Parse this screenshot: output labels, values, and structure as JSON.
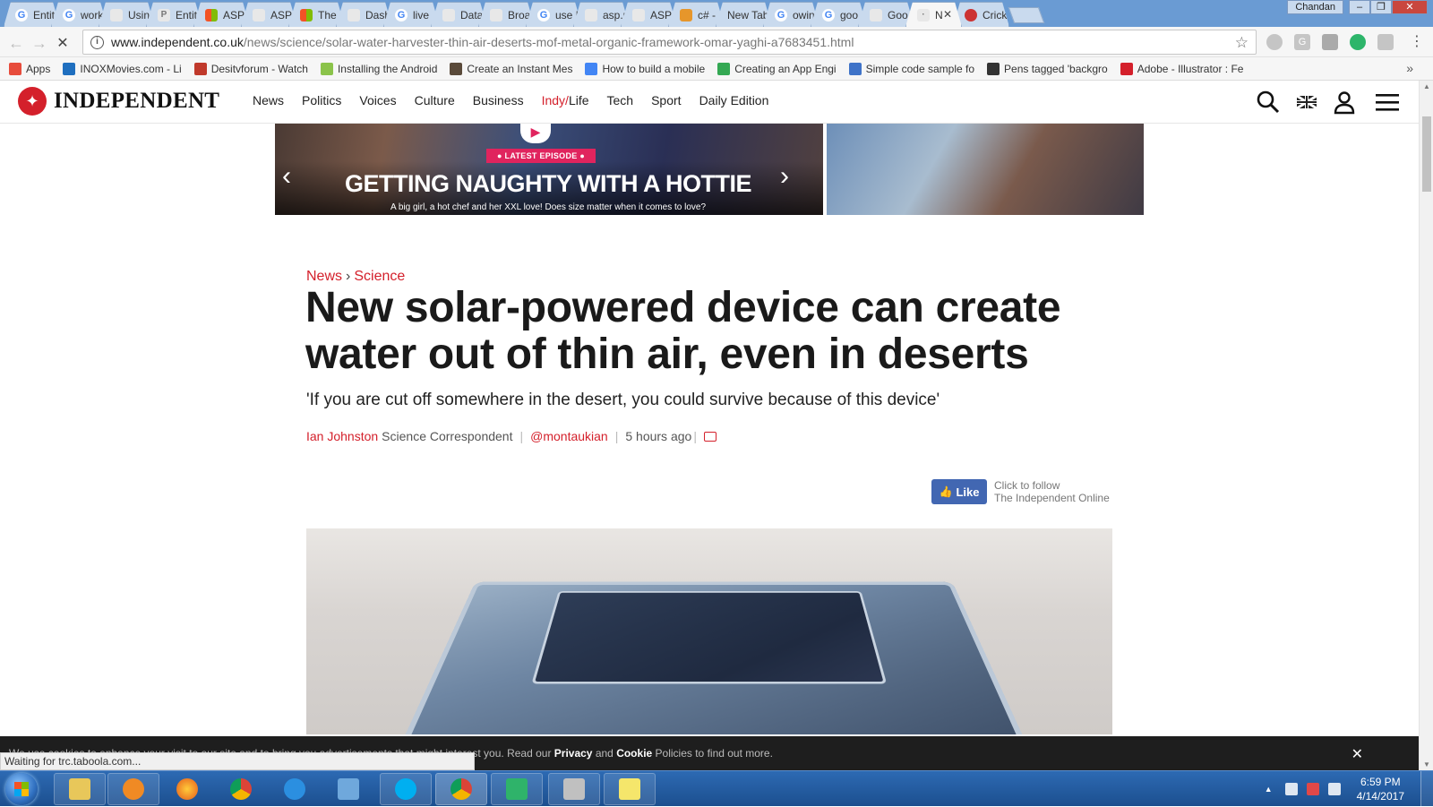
{
  "browser": {
    "tabs": [
      {
        "label": "Entit",
        "icon": "google-icon"
      },
      {
        "label": "work",
        "icon": "google-icon"
      },
      {
        "label": "Using",
        "icon": "site-icon"
      },
      {
        "label": "Entit",
        "icon": "p-icon"
      },
      {
        "label": "ASP.I",
        "icon": "microsoft-icon"
      },
      {
        "label": "ASP.",
        "icon": "site-icon"
      },
      {
        "label": "The",
        "icon": "microsoft-icon"
      },
      {
        "label": "Dash",
        "icon": "document-icon"
      },
      {
        "label": "live",
        "icon": "google-icon"
      },
      {
        "label": "Data",
        "icon": "site-icon"
      },
      {
        "label": "Broa",
        "icon": "site-icon"
      },
      {
        "label": "use I",
        "icon": "google-icon"
      },
      {
        "label": "asp.r",
        "icon": "site-icon"
      },
      {
        "label": "ASP.",
        "icon": "site-icon"
      },
      {
        "label": "c# -",
        "icon": "stack-icon"
      },
      {
        "label": "New Tab",
        "icon": ""
      },
      {
        "label": "owin",
        "icon": "google-icon"
      },
      {
        "label": "goo",
        "icon": "google-icon"
      },
      {
        "label": "Goo",
        "icon": "document-icon"
      },
      {
        "label": "N",
        "icon": "loading-icon",
        "active": true
      },
      {
        "label": "Crick",
        "icon": "cricket-icon"
      }
    ],
    "user": "Chandan",
    "url_host": "www.independent.co.uk",
    "url_path": "/news/science/solar-water-harvester-thin-air-deserts-mof-metal-organic-framework-omar-yaghi-a7683451.html",
    "bookmarks": [
      {
        "label": "Apps",
        "color": "#e74c3c"
      },
      {
        "label": "INOXMovies.com - Li",
        "color": "#1f6fbf"
      },
      {
        "label": "Desitvforum - Watch",
        "color": "#c0392b"
      },
      {
        "label": "Installing the Android",
        "color": "#8bc34a"
      },
      {
        "label": "Create an Instant Mes",
        "color": "#5a4a3a"
      },
      {
        "label": "How to build a mobile",
        "color": "#4285f4"
      },
      {
        "label": "Creating an App Engi",
        "color": "#34a853"
      },
      {
        "label": "Simple code sample fo",
        "color": "#3f73c8"
      },
      {
        "label": "Pens tagged 'backgro",
        "color": "#333333"
      },
      {
        "label": "Adobe - Illustrator : Fe",
        "color": "#d4202b"
      }
    ],
    "status_text": "Waiting for trc.taboola.com..."
  },
  "site": {
    "logo_text": "INDEPENDENT",
    "nav": [
      "News",
      "Politics",
      "Voices",
      "Culture",
      "Business",
      "Indy/",
      "Life",
      "Tech",
      "Sport",
      "Daily Edition"
    ]
  },
  "ad": {
    "tag": "● LATEST EPISODE ●",
    "headline": "GETTING NAUGHTY WITH A HOTTIE",
    "sub": "A big girl, a hot chef and her XXL love! Does size matter when it comes to love?"
  },
  "article": {
    "breadcrumb": [
      "News",
      "Science"
    ],
    "headline": "New solar-powered device can create water out of thin air, even in deserts",
    "standfirst": "'If you are cut off somewhere in the desert, you could survive because of this device'",
    "author": "Ian Johnston",
    "author_role": "Science Correspondent",
    "handle": "@montaukian",
    "time": "5 hours ago"
  },
  "facebook": {
    "like_label": "Like",
    "follow_line1": "Click to follow",
    "follow_line2": "The Independent Online"
  },
  "cookie": {
    "text_before": "We use cookies to enhance your visit to our site and to bring you advertisements that might interest you. Read our ",
    "privacy": "Privacy",
    "and": " and ",
    "cookie": "Cookie",
    "text_after": " Policies to find out more."
  },
  "taskbar": {
    "time": "6:59 PM",
    "date": "4/14/2017"
  }
}
